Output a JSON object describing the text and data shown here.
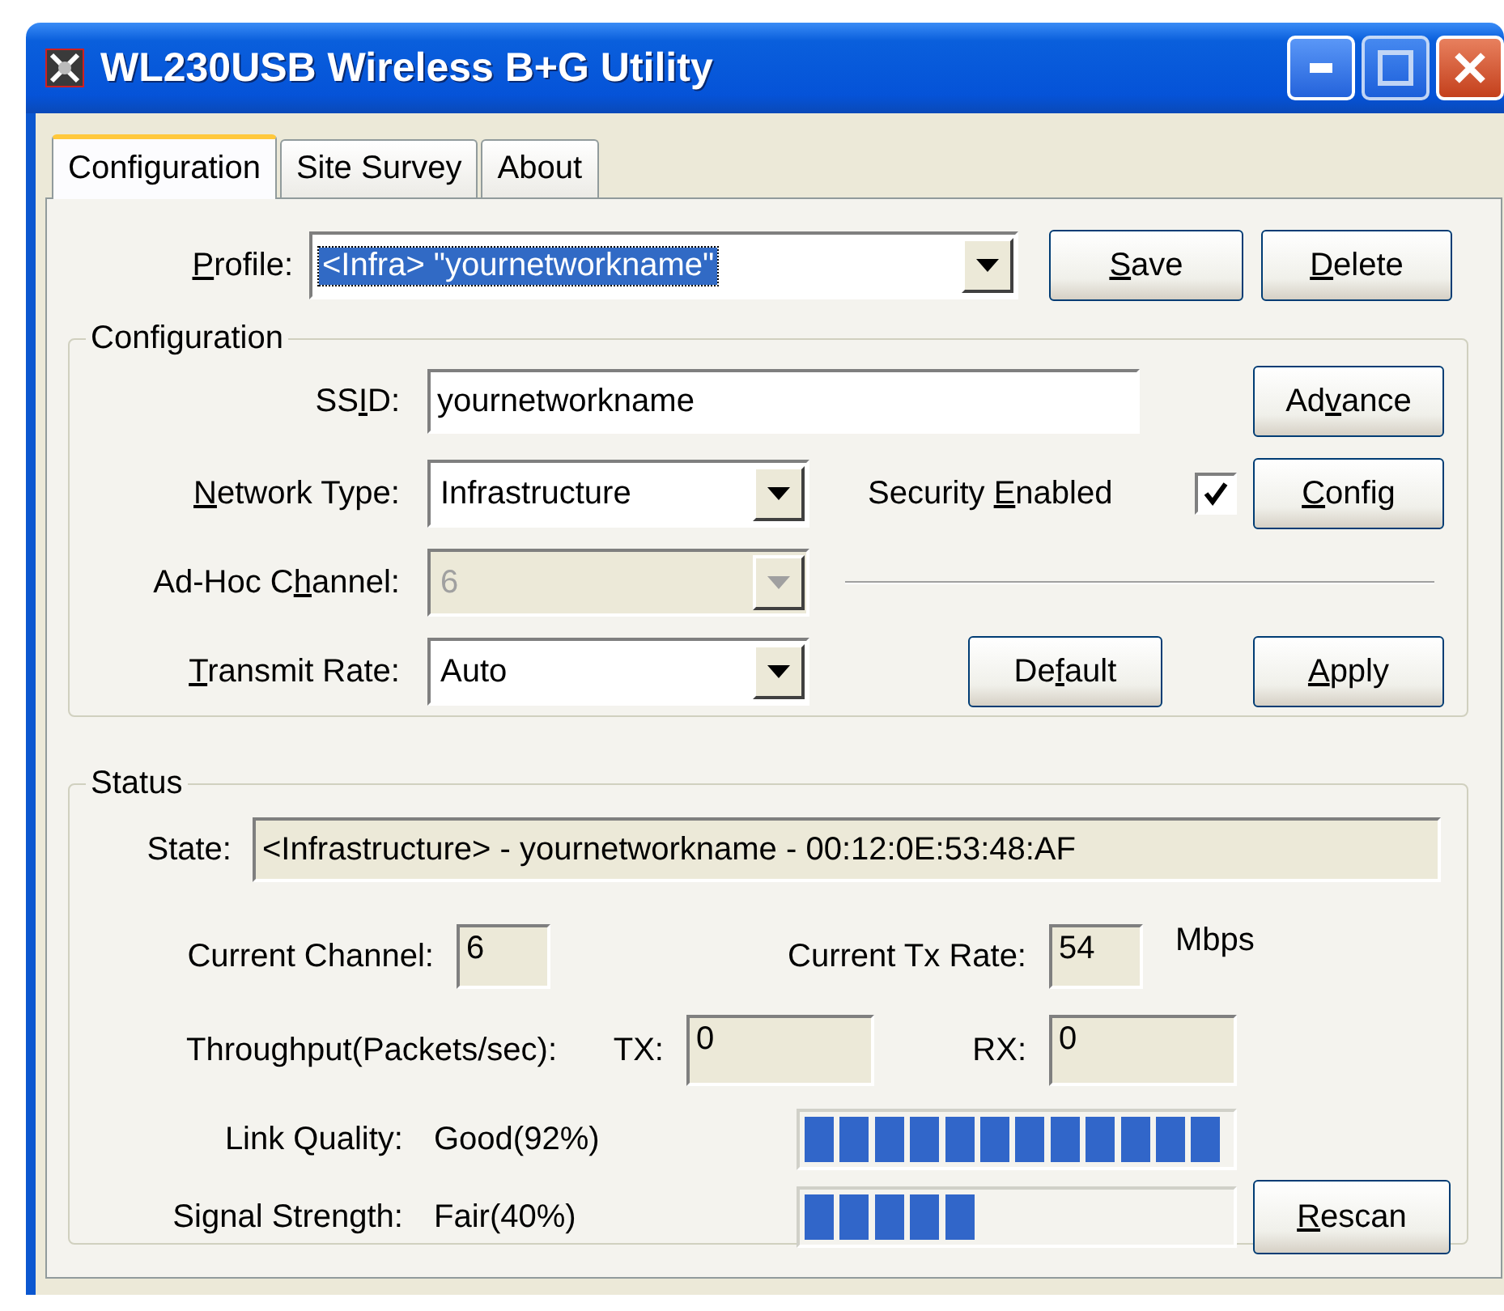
{
  "window": {
    "title": "WL230USB Wireless B+G Utility"
  },
  "tabs": [
    {
      "label": "Configuration",
      "selected": true
    },
    {
      "label": "Site Survey",
      "selected": false
    },
    {
      "label": "About",
      "selected": false
    }
  ],
  "profile": {
    "label": "Profile:",
    "value": "<Infra> \"yournetworkname\"",
    "highlighted": true,
    "buttons": [
      {
        "label": "Save"
      },
      {
        "label": "Delete"
      }
    ]
  },
  "configuration": {
    "title": "Configuration",
    "ssid": {
      "label": "SSID:",
      "value": "yournetworkname"
    },
    "advance_button": {
      "label": "Advance"
    },
    "network_type": {
      "label": "Network Type:",
      "value": "Infrastructure",
      "disabled": false
    },
    "security": {
      "label": "Security Enabled",
      "checked": true
    },
    "config_button": {
      "label": "Config"
    },
    "adhoc_channel": {
      "label": "Ad-Hoc Channel:",
      "value": "6",
      "disabled": true
    },
    "transmit_rate": {
      "label": "Transmit Rate:",
      "value": "Auto",
      "disabled": false
    },
    "default_button": {
      "label": "Default"
    },
    "apply_button": {
      "label": "Apply"
    }
  },
  "status": {
    "title": "Status",
    "state": {
      "label": "State:",
      "value": "<Infrastructure> - yournetworkname - 00:12:0E:53:48:AF"
    },
    "current_channel": {
      "label": "Current Channel:",
      "value": "6"
    },
    "current_tx_rate": {
      "label": "Current Tx Rate:",
      "value": "54",
      "unit": "Mbps"
    },
    "throughput": {
      "label": "Throughput(Packets/sec):",
      "tx_label": "TX:",
      "tx_value": "0",
      "rx_label": "RX:",
      "rx_value": "0"
    },
    "link_quality": {
      "label": "Link Quality:",
      "value": "Good(92%)",
      "level": 0.92
    },
    "signal_strength": {
      "label": "Signal Strength:",
      "value": "Fair(40%)",
      "level": 0.4
    },
    "rescan_button": {
      "label": "Rescan"
    }
  }
}
